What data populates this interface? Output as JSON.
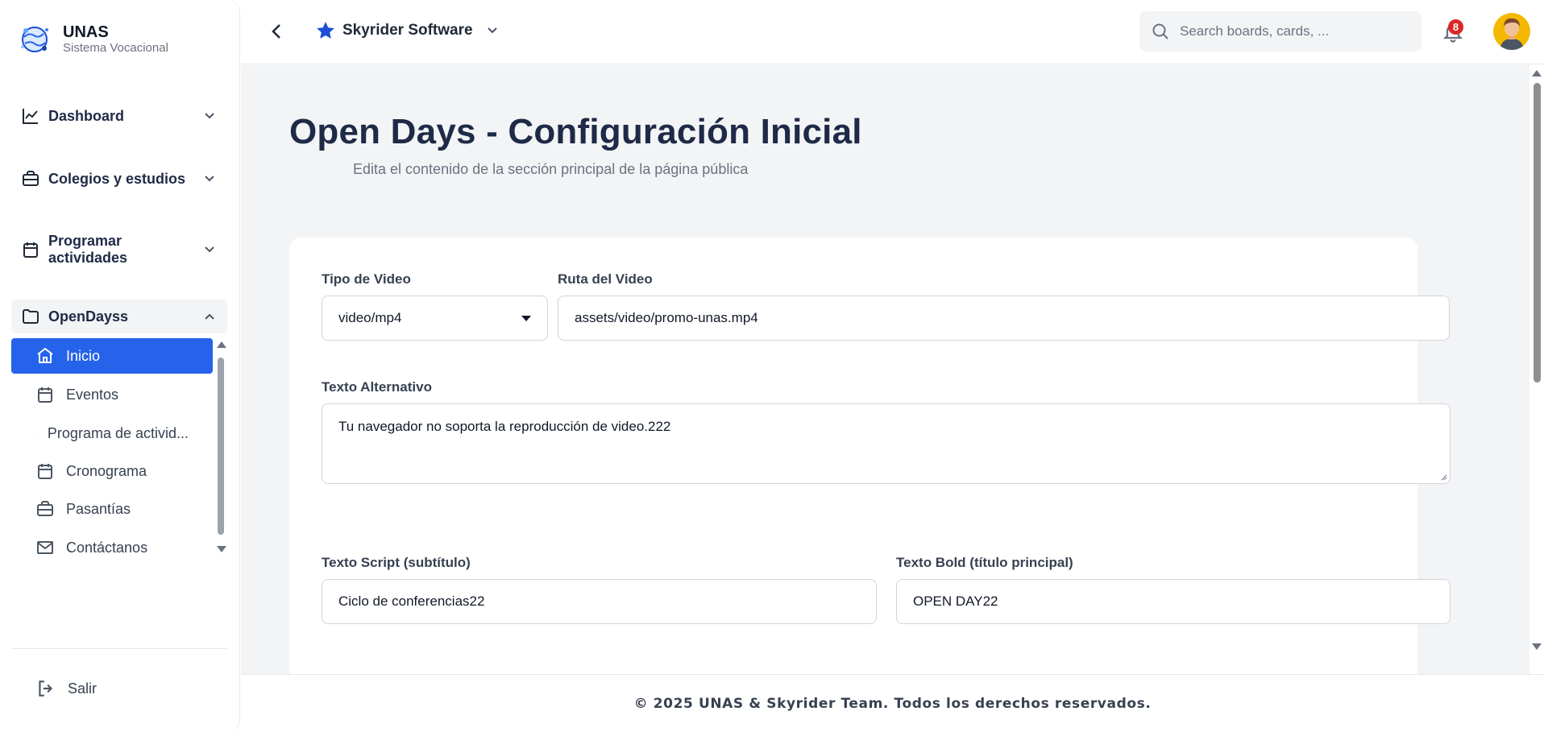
{
  "brand": {
    "name": "UNAS",
    "subtitle": "Sistema Vocacional"
  },
  "sidebar": {
    "groups": [
      {
        "label": "Dashboard",
        "icon": "chart-line-icon",
        "expanded": false
      },
      {
        "label": "Colegios y estudios",
        "icon": "briefcase-icon",
        "expanded": false
      },
      {
        "label": "Programar actividades",
        "icon": "calendar-icon",
        "expanded": false
      },
      {
        "label": "OpenDayss",
        "icon": "folder-icon",
        "expanded": true
      }
    ],
    "items": [
      {
        "label": "Inicio",
        "icon": "home-icon",
        "active": true
      },
      {
        "label": "Eventos",
        "icon": "calendar-icon",
        "active": false
      },
      {
        "label": "Programa de activid...",
        "icon": "chat-icon",
        "active": false
      },
      {
        "label": "Cronograma",
        "icon": "calendar-icon",
        "active": false
      },
      {
        "label": "Pasantías",
        "icon": "briefcase-icon",
        "active": false
      },
      {
        "label": "Contáctanos",
        "icon": "mail-icon",
        "active": false
      }
    ],
    "logout_label": "Salir"
  },
  "header": {
    "workspace": "Skyrider Software",
    "search_placeholder": "Search boards, cards, ...",
    "notifications_count": "8"
  },
  "page": {
    "title": "Open Days - Configuración Inicial",
    "subtitle": "Edita el contenido de la sección principal de la página pública"
  },
  "form": {
    "video_type_label": "Tipo de Video",
    "video_type_value": "video/mp4",
    "video_path_label": "Ruta del Video",
    "video_path_value": "assets/video/promo-unas.mp4",
    "alt_text_label": "Texto Alternativo",
    "alt_text_value": "Tu navegador no soporta la reproducción de video.222",
    "script_text_label": "Texto Script (subtítulo)",
    "script_text_value": "Ciclo de conferencias22",
    "bold_text_label": "Texto Bold (título principal)",
    "bold_text_value": "OPEN DAY22"
  },
  "footer": {
    "text": "© 2025 UNAS & Skyrider Team. Todos los derechos reservados."
  },
  "colors": {
    "accent": "#2563eb",
    "title": "#1e2a47",
    "badge": "#dc2626",
    "background": "#f3f4f6"
  }
}
